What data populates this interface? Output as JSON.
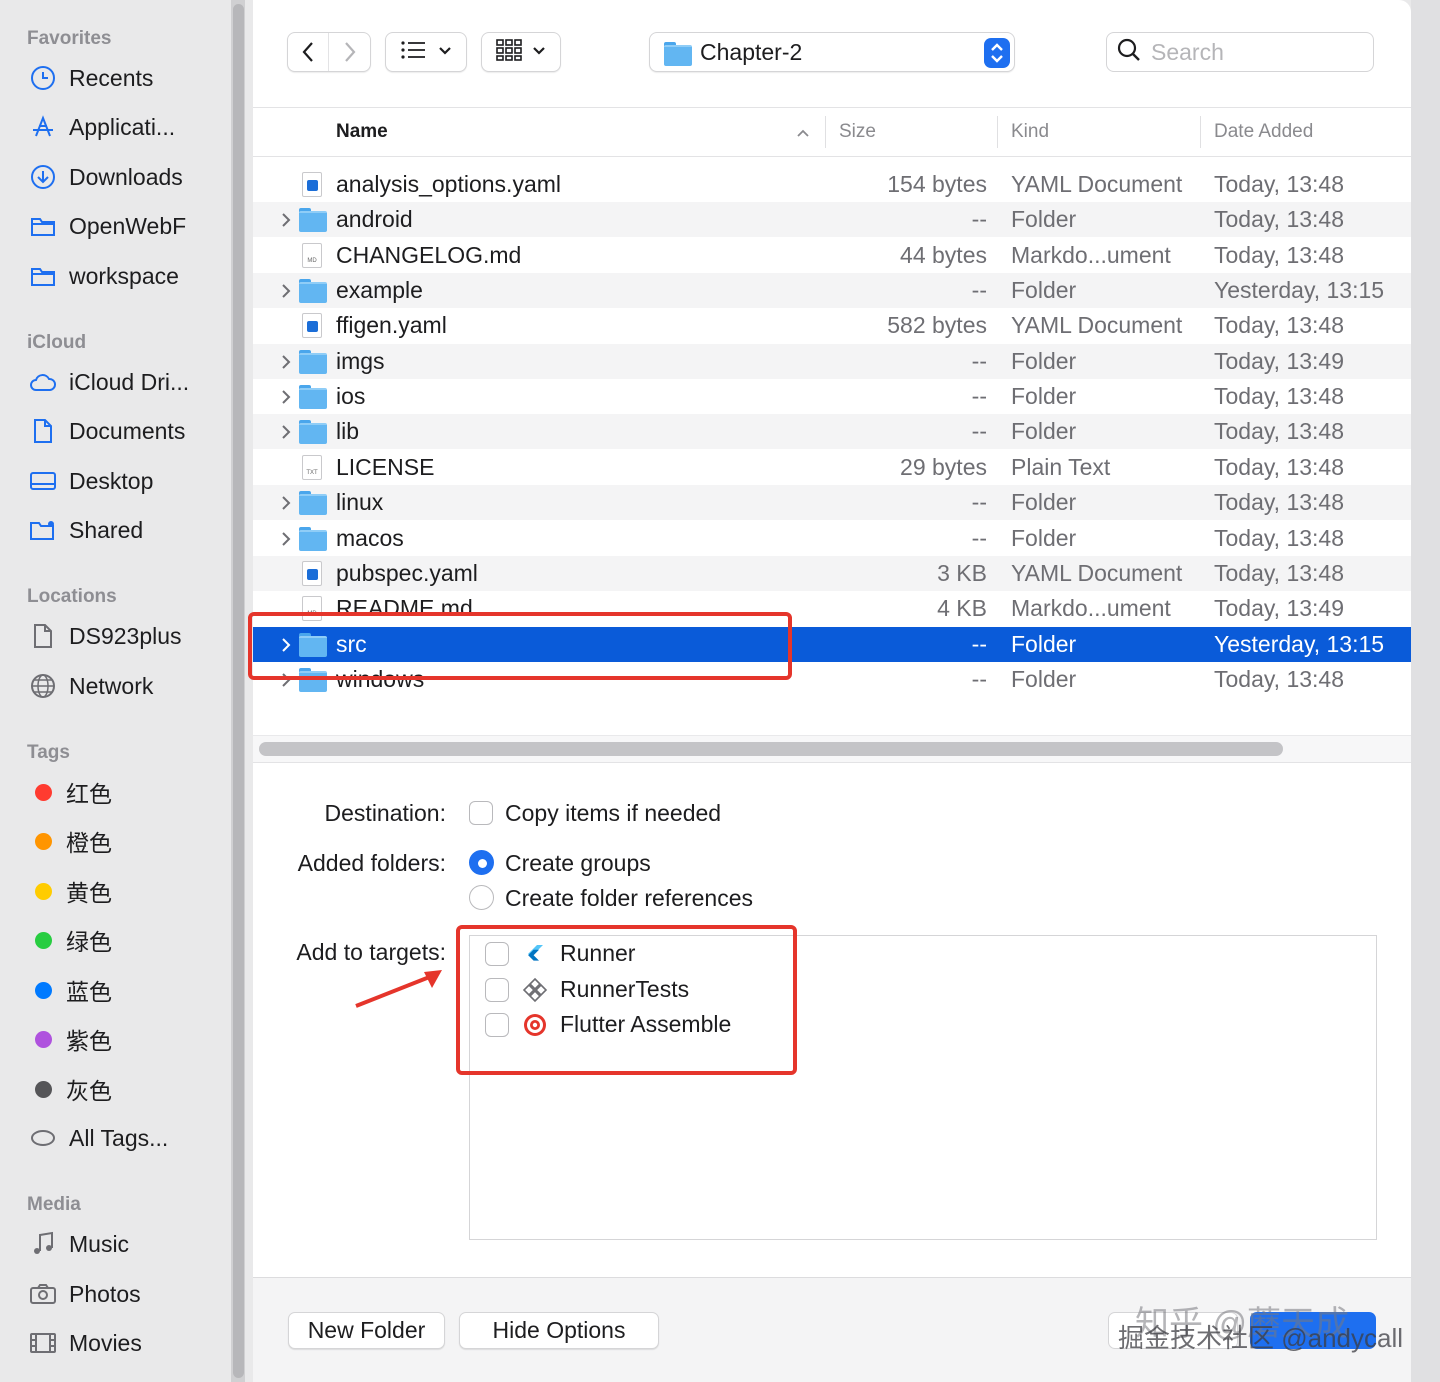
{
  "sidebar": {
    "favorites_heading": "Favorites",
    "favorites": [
      {
        "label": "Recents",
        "icon": "clock-icon"
      },
      {
        "label": "Applicati...",
        "icon": "applications-icon"
      },
      {
        "label": "Downloads",
        "icon": "download-icon"
      },
      {
        "label": "OpenWebF",
        "icon": "folder-icon"
      },
      {
        "label": "workspace",
        "icon": "folder-icon"
      }
    ],
    "icloud_heading": "iCloud",
    "icloud": [
      {
        "label": "iCloud Dri...",
        "icon": "cloud-icon"
      },
      {
        "label": "Documents",
        "icon": "document-icon"
      },
      {
        "label": "Desktop",
        "icon": "desktop-icon"
      },
      {
        "label": "Shared",
        "icon": "shared-folder-icon"
      }
    ],
    "locations_heading": "Locations",
    "locations": [
      {
        "label": "DS923plus",
        "icon": "document-icon"
      },
      {
        "label": "Network",
        "icon": "globe-icon"
      }
    ],
    "tags_heading": "Tags",
    "tags": [
      {
        "label": "红色",
        "color": "#ff3b30"
      },
      {
        "label": "橙色",
        "color": "#ff9500"
      },
      {
        "label": "黄色",
        "color": "#ffcc00"
      },
      {
        "label": "绿色",
        "color": "#28cd41"
      },
      {
        "label": "蓝色",
        "color": "#007aff"
      },
      {
        "label": "紫色",
        "color": "#af52de"
      },
      {
        "label": "灰色",
        "color": "#8e8e93"
      }
    ],
    "all_tags": "All Tags...",
    "media_heading": "Media",
    "media": [
      {
        "label": "Music",
        "icon": "music-icon"
      },
      {
        "label": "Photos",
        "icon": "camera-icon"
      },
      {
        "label": "Movies",
        "icon": "film-icon"
      }
    ]
  },
  "toolbar": {
    "back_icon": "chevron-left-icon",
    "forward_icon": "chevron-right-icon",
    "view_list_icon": "list-view-icon",
    "view_grid_icon": "grid-view-icon",
    "folder": "Chapter-2",
    "search_placeholder": "Search"
  },
  "columns": {
    "name": "Name",
    "size": "Size",
    "kind": "Kind",
    "date": "Date Added"
  },
  "files": [
    {
      "name": "analysis_options.yaml",
      "size": "154 bytes",
      "kind": "YAML Document",
      "date": "Today, 13:48",
      "type": "yaml"
    },
    {
      "name": "android",
      "size": "--",
      "kind": "Folder",
      "date": "Today, 13:48",
      "type": "folder"
    },
    {
      "name": "CHANGELOG.md",
      "size": "44 bytes",
      "kind": "Markdo...ument",
      "date": "Today, 13:48",
      "type": "doc",
      "badge": "MD"
    },
    {
      "name": "example",
      "size": "--",
      "kind": "Folder",
      "date": "Yesterday, 13:15",
      "type": "folder"
    },
    {
      "name": "ffigen.yaml",
      "size": "582 bytes",
      "kind": "YAML Document",
      "date": "Today, 13:48",
      "type": "yaml"
    },
    {
      "name": "imgs",
      "size": "--",
      "kind": "Folder",
      "date": "Today, 13:49",
      "type": "folder"
    },
    {
      "name": "ios",
      "size": "--",
      "kind": "Folder",
      "date": "Today, 13:48",
      "type": "folder"
    },
    {
      "name": "lib",
      "size": "--",
      "kind": "Folder",
      "date": "Today, 13:48",
      "type": "folder"
    },
    {
      "name": "LICENSE",
      "size": "29 bytes",
      "kind": "Plain Text",
      "date": "Today, 13:48",
      "type": "doc",
      "badge": "TXT"
    },
    {
      "name": "linux",
      "size": "--",
      "kind": "Folder",
      "date": "Today, 13:48",
      "type": "folder"
    },
    {
      "name": "macos",
      "size": "--",
      "kind": "Folder",
      "date": "Today, 13:48",
      "type": "folder"
    },
    {
      "name": "pubspec.yaml",
      "size": "3 KB",
      "kind": "YAML Document",
      "date": "Today, 13:48",
      "type": "yaml"
    },
    {
      "name": "README.md",
      "size": "4 KB",
      "kind": "Markdo...ument",
      "date": "Today, 13:49",
      "type": "doc",
      "badge": "MD"
    },
    {
      "name": "src",
      "size": "--",
      "kind": "Folder",
      "date": "Yesterday, 13:15",
      "type": "folder",
      "selected": true
    },
    {
      "name": "windows",
      "size": "--",
      "kind": "Folder",
      "date": "Today, 13:48",
      "type": "folder"
    }
  ],
  "options": {
    "destination_label": "Destination:",
    "copy_items": "Copy items if needed",
    "added_folders_label": "Added folders:",
    "create_groups": "Create groups",
    "create_folder_refs": "Create folder references",
    "add_to_targets_label": "Add to targets:",
    "targets": [
      {
        "label": "Runner",
        "icon": "flutter-icon"
      },
      {
        "label": "RunnerTests",
        "icon": "test-bundle-icon"
      },
      {
        "label": "Flutter Assemble",
        "icon": "target-icon"
      }
    ]
  },
  "footer": {
    "new_folder": "New Folder",
    "hide_options": "Hide Options"
  },
  "watermark": {
    "line1": "知乎 @蘑天成",
    "line2": "掘金技术社区 @andycall"
  },
  "colors": {
    "selection": "#0a5bd9",
    "accent": "#1e6ff0",
    "annotation": "#e5352b"
  }
}
